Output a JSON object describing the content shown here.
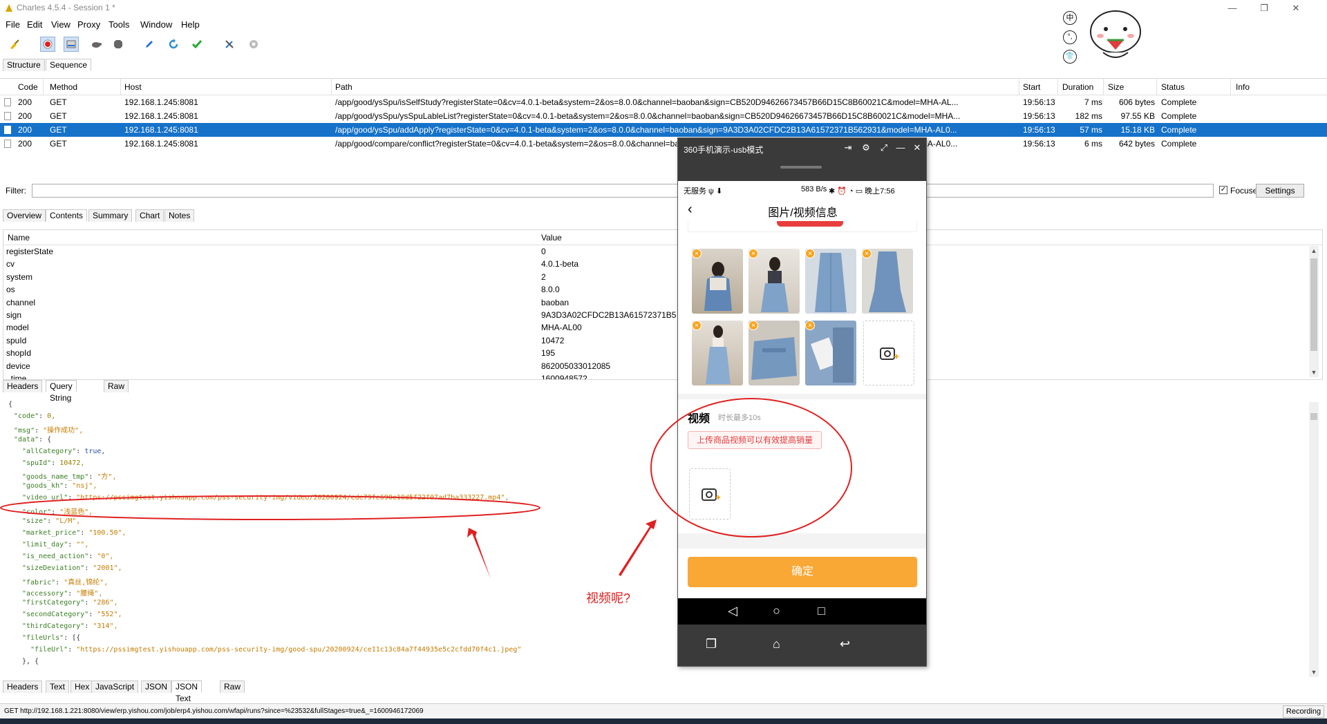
{
  "window": {
    "title": "Charles 4.5.4 - Session 1 *",
    "controls": [
      "—",
      "❐",
      "✕"
    ]
  },
  "menu": [
    "File",
    "Edit",
    "View",
    "Proxy",
    "Tools",
    "Window",
    "Help"
  ],
  "toolbar": {
    "icons": [
      "broom-icon",
      "record-icon",
      "throttle-icon",
      "turtle-icon",
      "stop-icon",
      "compose-icon",
      "refresh-icon",
      "validate-icon",
      "tools-icon",
      "settings-gear-icon"
    ]
  },
  "view_tabs": [
    "Structure",
    "Sequence"
  ],
  "request_table": {
    "columns": [
      "Code",
      "Method",
      "Host",
      "Path",
      "Start",
      "Duration",
      "Size",
      "Status",
      "Info"
    ],
    "rows": [
      {
        "code": "200",
        "method": "GET",
        "host": "192.168.1.245:8081",
        "path": "/app/good/ysSpu/isSelfStudy?registerState=0&cv=4.0.1-beta&system=2&os=8.0.0&channel=baoban&sign=CB520D94626673457B66D15C8B60021C&model=MHA-AL...",
        "start": "19:56:13",
        "duration": "7 ms",
        "size": "606 bytes",
        "status": "Complete"
      },
      {
        "code": "200",
        "method": "GET",
        "host": "192.168.1.245:8081",
        "path": "/app/good/ysSpu/ysSpuLableList?registerState=0&cv=4.0.1-beta&system=2&os=8.0.0&channel=baoban&sign=CB520D94626673457B66D15C8B60021C&model=MHA...",
        "start": "19:56:13",
        "duration": "182 ms",
        "size": "97.55 KB",
        "status": "Complete"
      },
      {
        "code": "200",
        "method": "GET",
        "host": "192.168.1.245:8081",
        "path": "/app/good/ysSpu/addApply?registerState=0&cv=4.0.1-beta&system=2&os=8.0.0&channel=baoban&sign=9A3D3A02CFDC2B13A61572371B562931&model=MHA-AL0...",
        "start": "19:56:13",
        "duration": "57 ms",
        "size": "15.18 KB",
        "status": "Complete"
      },
      {
        "code": "200",
        "method": "GET",
        "host": "192.168.1.245:8081",
        "path": "/app/good/compare/conflict?registerState=0&cv=4.0.1-beta&system=2&os=8.0.0&channel=baoban&sign=9A3D3A02CFDC2B13A61572371B562931&model=MHA-AL0...",
        "start": "19:56:13",
        "duration": "6 ms",
        "size": "642 bytes",
        "status": "Complete"
      }
    ],
    "selected_index": 2
  },
  "filter": {
    "label": "Filter:",
    "value": "",
    "focused_label": "Focused",
    "focused_checked": true,
    "settings_label": "Settings"
  },
  "detail_tabs": [
    "Overview",
    "Contents",
    "Summary",
    "Chart",
    "Notes"
  ],
  "request_params": {
    "columns": [
      "Name",
      "Value"
    ],
    "rows": [
      {
        "name": "registerState",
        "value": "0"
      },
      {
        "name": "cv",
        "value": "4.0.1-beta"
      },
      {
        "name": "system",
        "value": "2"
      },
      {
        "name": "os",
        "value": "8.0.0"
      },
      {
        "name": "channel",
        "value": "baoban"
      },
      {
        "name": "sign",
        "value": "9A3D3A02CFDC2B13A61572371B5"
      },
      {
        "name": "model",
        "value": "MHA-AL00"
      },
      {
        "name": "spuId",
        "value": "10472"
      },
      {
        "name": "shopId",
        "value": "195"
      },
      {
        "name": "device",
        "value": "862005033012085"
      },
      {
        "name": "_time",
        "value": "1600948572"
      }
    ]
  },
  "request_tabs": [
    "Headers",
    "Query String",
    "Raw"
  ],
  "response_json": [
    {
      "i": 0,
      "p": "{"
    },
    {
      "i": 1,
      "k": "\"code\"",
      "v": "0,",
      "t": "jn"
    },
    {
      "i": 1,
      "k": "\"msg\"",
      "v": "\"操作成功\",",
      "t": "js"
    },
    {
      "i": 1,
      "k": "\"data\"",
      "v": "{",
      "t": "jp"
    },
    {
      "i": 2,
      "k": "\"allCategory\"",
      "v": "true,",
      "t": "jb"
    },
    {
      "i": 2,
      "k": "\"spuId\"",
      "v": "10472,",
      "t": "jn"
    },
    {
      "i": 2,
      "k": "\"goods_name_tmp\"",
      "v": "\"方\",",
      "t": "js"
    },
    {
      "i": 2,
      "k": "\"goods_kh\"",
      "v": "\"nsj\",",
      "t": "js"
    },
    {
      "i": 2,
      "k": "\"video_url\"",
      "v": "\"https://pssimgtest.yishouapp.com/pss-security-img/video/20200924/ede79fe690e10d5f22f07ad7ba333227.mp4\",",
      "t": "js"
    },
    {
      "i": 2,
      "k": "\"color\"",
      "v": "\"浅蓝色\",",
      "t": "js"
    },
    {
      "i": 2,
      "k": "\"size\"",
      "v": "\"L/M\",",
      "t": "js"
    },
    {
      "i": 2,
      "k": "\"market_price\"",
      "v": "\"100.50\",",
      "t": "js"
    },
    {
      "i": 2,
      "k": "\"limit_day\"",
      "v": "\"\",",
      "t": "js"
    },
    {
      "i": 2,
      "k": "\"is_need_action\"",
      "v": "\"0\",",
      "t": "js"
    },
    {
      "i": 2,
      "k": "\"sizeDeviation\"",
      "v": "\"2001\",",
      "t": "js"
    },
    {
      "i": 2,
      "k": "\"fabric\"",
      "v": "\"真丝,锦纶\",",
      "t": "js"
    },
    {
      "i": 2,
      "k": "\"accessory\"",
      "v": "\"腰绳\",",
      "t": "js"
    },
    {
      "i": 2,
      "k": "\"firstCategory\"",
      "v": "\"286\",",
      "t": "js"
    },
    {
      "i": 2,
      "k": "\"secondCategory\"",
      "v": "\"552\",",
      "t": "js"
    },
    {
      "i": 2,
      "k": "\"thirdCategory\"",
      "v": "\"314\",",
      "t": "js"
    },
    {
      "i": 2,
      "k": "\"fileUrls\"",
      "v": "[{",
      "t": "jp"
    },
    {
      "i": 3,
      "k": "\"fileUrl\"",
      "v": "\"https://pssimgtest.yishouapp.com/pss-security-img/good-spu/20200924/ce11c13c84a7f44935e5c2cfdd70f4c1.jpeg\"",
      "t": "js"
    },
    {
      "i": 2,
      "p": "}, {"
    }
  ],
  "response_tabs": [
    "Headers",
    "Text",
    "Hex",
    "JavaScript",
    "JSON",
    "JSON Text",
    "Raw"
  ],
  "status_bar": {
    "url": "GET http://192.168.1.221:8080/view/erp.yishou.com/job/erp4.yishou.com/wfapi/runs?since=%23532&fullStages=true&_=1600946172069",
    "recording_label": "Recording"
  },
  "phone": {
    "window_title": "360手机演示-usb模式",
    "status_left": "无服务 ψ ⬇",
    "status_speed": "583 B/s",
    "status_right": "✱ ⏰ ◔ ▭ 晚上7:56",
    "page_title": "图片/视频信息",
    "video_title": "视频",
    "video_subtitle": "时长最多10s",
    "video_badge": "上传商品视频可以有效提高销量",
    "confirm_label": "确定"
  },
  "annotation": {
    "text": "视频呢?"
  },
  "sticker": {
    "chars": [
      "中",
      "°,",
      "👕"
    ]
  },
  "colors": {
    "selection": "#1672c9",
    "annotation_red": "#e02020",
    "confirm_orange": "#f9a836",
    "json_key": "#3a7d23",
    "json_string": "#c67b00"
  }
}
